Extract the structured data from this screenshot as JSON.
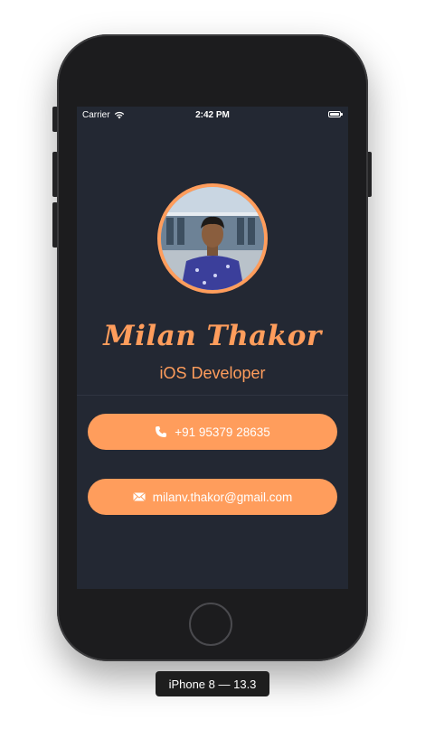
{
  "device": {
    "label": "iPhone 8 — 13.3"
  },
  "statusbar": {
    "carrier": "Carrier",
    "time": "2:42 PM"
  },
  "profile": {
    "name": "Milan Thakor",
    "role": "iOS Developer",
    "phone": "+91 95379 28635",
    "email": "milanv.thakor@gmail.com"
  },
  "colors": {
    "accent": "#ff9d5c",
    "background": "#232833",
    "text_on_accent": "#ffffff"
  },
  "icons": {
    "phone": "phone-icon",
    "email": "envelope-icon",
    "wifi": "wifi-icon",
    "battery": "battery-icon"
  }
}
